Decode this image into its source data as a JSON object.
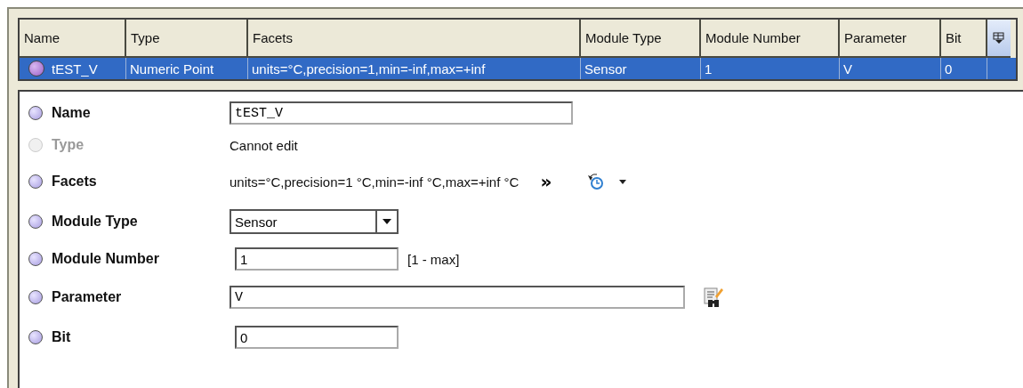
{
  "table": {
    "columns": [
      "Name",
      "Type",
      "Facets",
      "Module Type",
      "Module Number",
      "Parameter",
      "Bit"
    ],
    "rows": [
      {
        "selected": true,
        "cells": [
          "tEST_V",
          "Numeric Point",
          "units=°C,precision=1,min=-inf,max=+inf",
          "Sensor",
          "1",
          "V",
          "0"
        ]
      }
    ]
  },
  "properties": [
    {
      "kind": "text",
      "label": "Name",
      "enabled": true,
      "value": "tEST_V"
    },
    {
      "kind": "readonly",
      "label": "Type",
      "enabled": false,
      "value": "Cannot edit"
    },
    {
      "kind": "facets",
      "label": "Facets",
      "enabled": true,
      "value": "units=°C,precision=1 °C,min=-inf °C,max=+inf °C",
      "more": "»"
    },
    {
      "kind": "dropdown",
      "label": "Module Type",
      "enabled": true,
      "value": "Sensor"
    },
    {
      "kind": "number",
      "label": "Module Number",
      "enabled": true,
      "value": "1",
      "range": "[1 - max]"
    },
    {
      "kind": "lookup",
      "label": "Parameter",
      "enabled": true,
      "value": "V"
    },
    {
      "kind": "number",
      "label": "Bit",
      "enabled": true,
      "value": "0"
    }
  ]
}
